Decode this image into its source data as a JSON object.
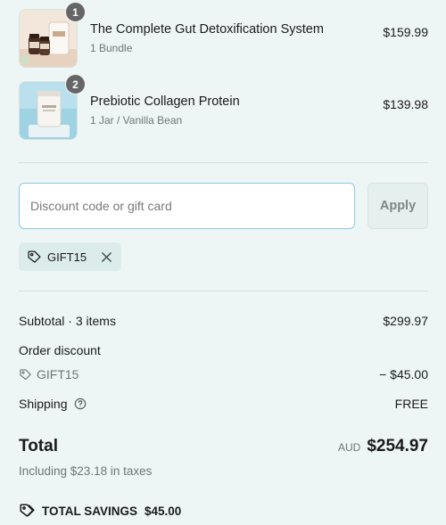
{
  "line_items": [
    {
      "quantity": "1",
      "title": "The Complete Gut Detoxification System",
      "variant": "1 Bundle",
      "price": "$159.99",
      "image_icon": "gut-detox-bundle-image"
    },
    {
      "quantity": "2",
      "title": "Prebiotic Collagen Protein",
      "variant": "1 Jar / Vanilla Bean",
      "price": "$139.98",
      "image_icon": "collagen-jar-image"
    }
  ],
  "discount": {
    "placeholder": "Discount code or gift card",
    "value": "",
    "apply_label": "Apply",
    "applied_code": "GIFT15"
  },
  "summary": {
    "subtotal_label": "Subtotal · 3 items",
    "subtotal_value": "$299.97",
    "order_discount_label": "Order discount",
    "discount_code": "GIFT15",
    "discount_value": "− $45.00",
    "shipping_label": "Shipping",
    "shipping_value": "FREE",
    "total_label": "Total",
    "currency": "AUD",
    "total_value": "$254.97",
    "tax_note": "Including $23.18 in taxes",
    "savings_label": "TOTAL SAVINGS",
    "savings_value": "$45.00"
  },
  "colors": {
    "background": "#eef6f5",
    "input_focus_border": "#8fc7e6",
    "badge": "#666666"
  }
}
